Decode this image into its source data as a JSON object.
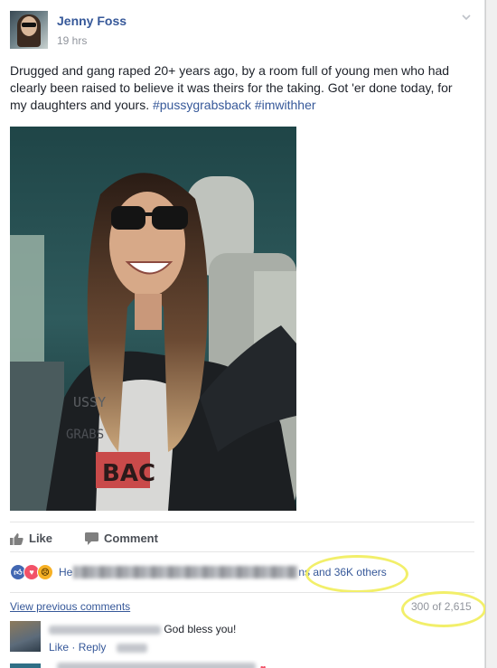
{
  "post": {
    "author": "Jenny Foss",
    "timestamp": "19 hrs",
    "text": "Drugged and gang raped 20+ years ago, by a room full of young men who had clearly been raised to believe it was theirs for the taking. Got 'er done today, for my daughters and yours.",
    "hashtags": [
      "#pussygrabsback",
      "#imwithher"
    ],
    "photo": {
      "shirt_text_line1": "USSY",
      "shirt_text_line2": "GRABS",
      "shirt_text_line3": "BAC"
    }
  },
  "actions": {
    "like_label": "Like",
    "comment_label": "Comment"
  },
  "reactions": {
    "lead_fragment": "He",
    "tail_fragment": "ns and 36K others"
  },
  "comments": {
    "view_previous_label": "View previous comments",
    "count_label": "300 of 2,615",
    "first": {
      "text": "God bless you!",
      "like_label": "Like",
      "reply_label": "Reply"
    }
  },
  "colors": {
    "link": "#365899",
    "highlight": "#f2ef6a",
    "like_reaction": "#4267b2",
    "love_reaction": "#f25268",
    "sad_reaction": "#f7b125"
  },
  "icons": {
    "menu": "chevron-down-icon",
    "like": "thumbs-up-icon",
    "comment": "speech-bubble-icon"
  }
}
